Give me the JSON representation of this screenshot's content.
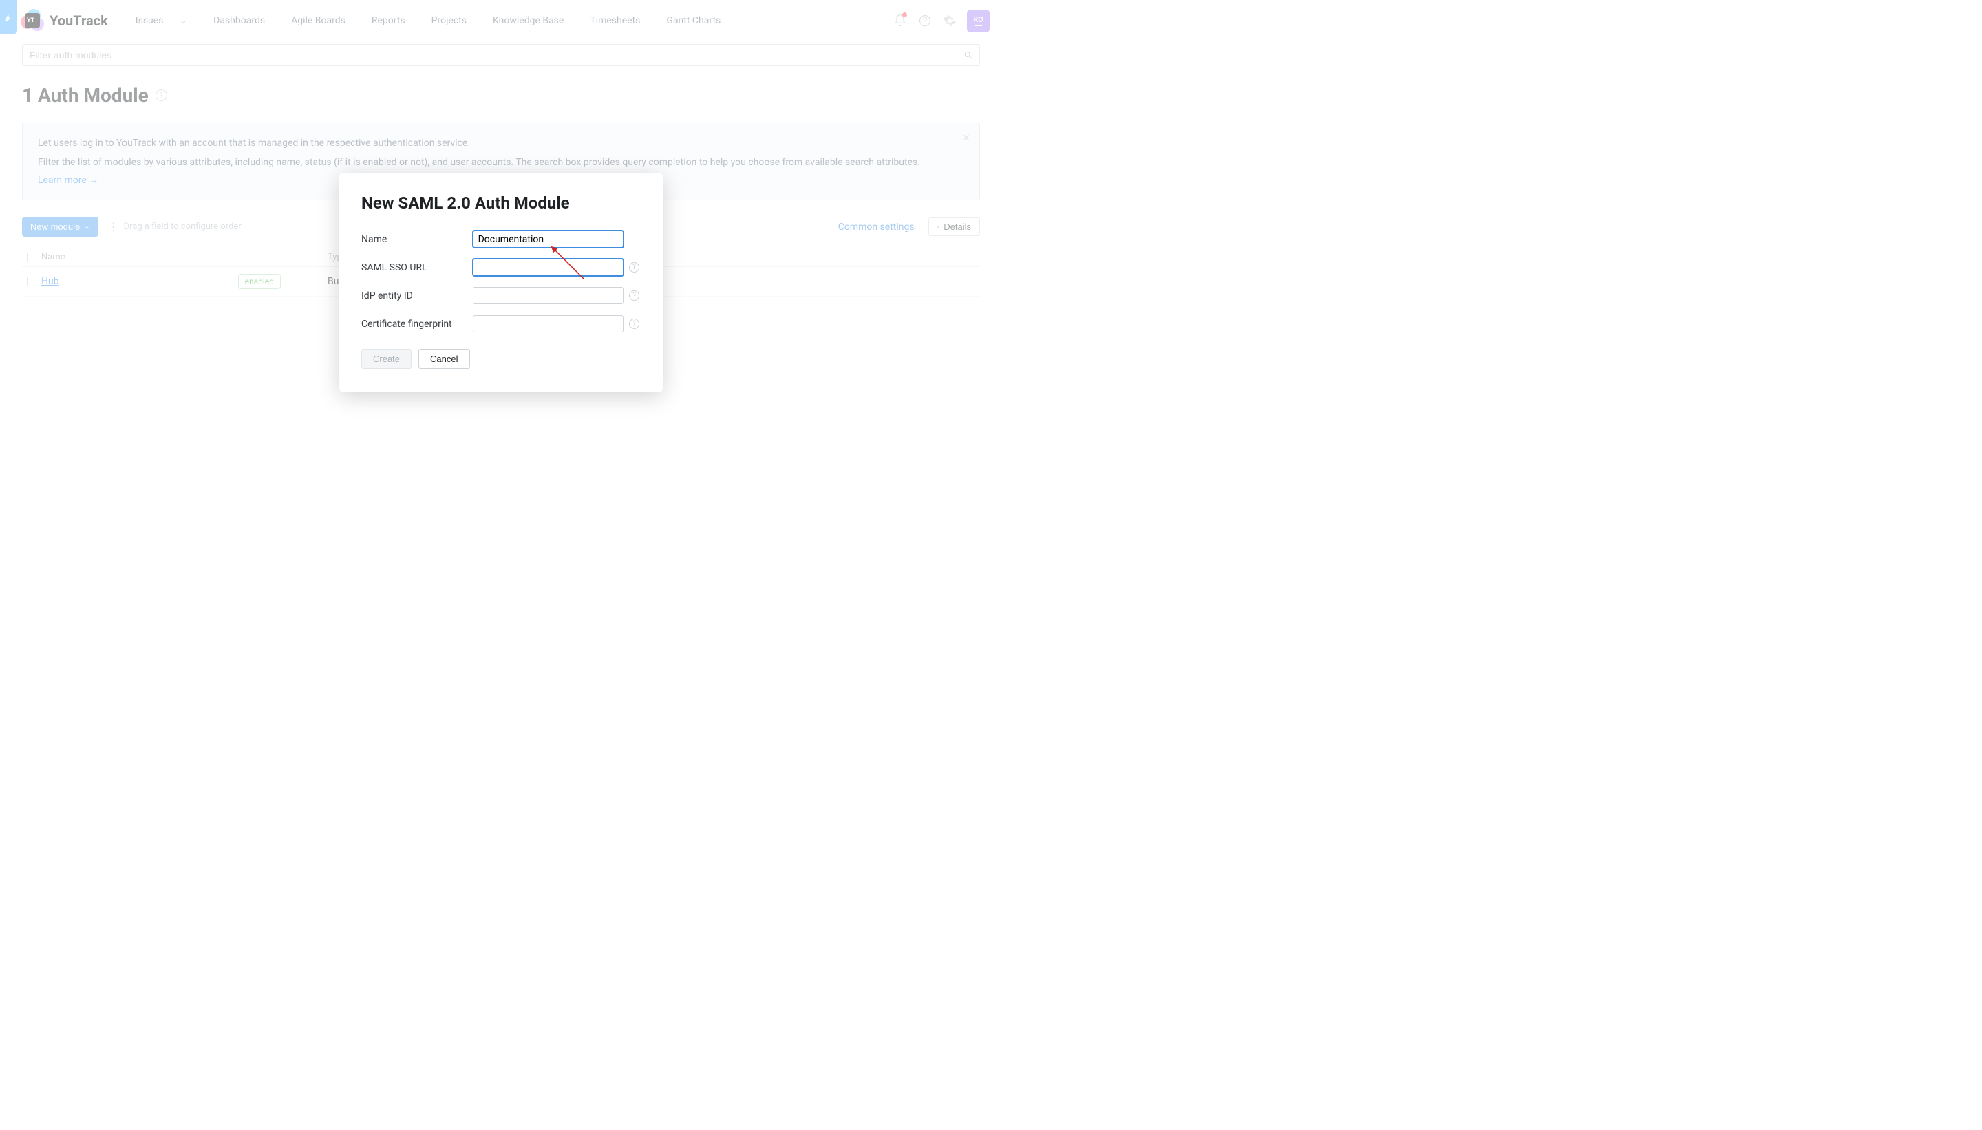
{
  "product_name": "YouTrack",
  "nav": {
    "issues": "Issues",
    "dashboards": "Dashboards",
    "agile": "Agile Boards",
    "reports": "Reports",
    "projects": "Projects",
    "kb": "Knowledge Base",
    "timesheets": "Timesheets",
    "gantt": "Gantt Charts"
  },
  "avatar_initials": "RO",
  "filter_placeholder": "Filter auth modules",
  "page_title": "1 Auth Module",
  "info": {
    "line1": "Let users log in to YouTrack with an account that is managed in the respective authentication service.",
    "line2": "Filter the list of modules by various attributes, including name, status (if it is enabled or not), and user accounts. The search box provides query completion to help you choose from available search attributes.",
    "learn_more": "Learn more →"
  },
  "toolbar": {
    "new_module": "New module",
    "drag_hint": "Drag a field to configure order",
    "common_settings": "Common settings",
    "details": "Details"
  },
  "table": {
    "col_name": "Name",
    "col_type": "Typ",
    "row_name": "Hub",
    "row_status": "enabled",
    "row_type": "Bu"
  },
  "dialog": {
    "title": "New SAML 2.0 Auth Module",
    "name_label": "Name",
    "name_value": "Documentation",
    "sso_label": "SAML SSO URL",
    "sso_value": "",
    "idp_label": "IdP entity ID",
    "idp_value": "",
    "cert_label": "Certificate fingerprint",
    "cert_value": "",
    "create": "Create",
    "cancel": "Cancel"
  }
}
